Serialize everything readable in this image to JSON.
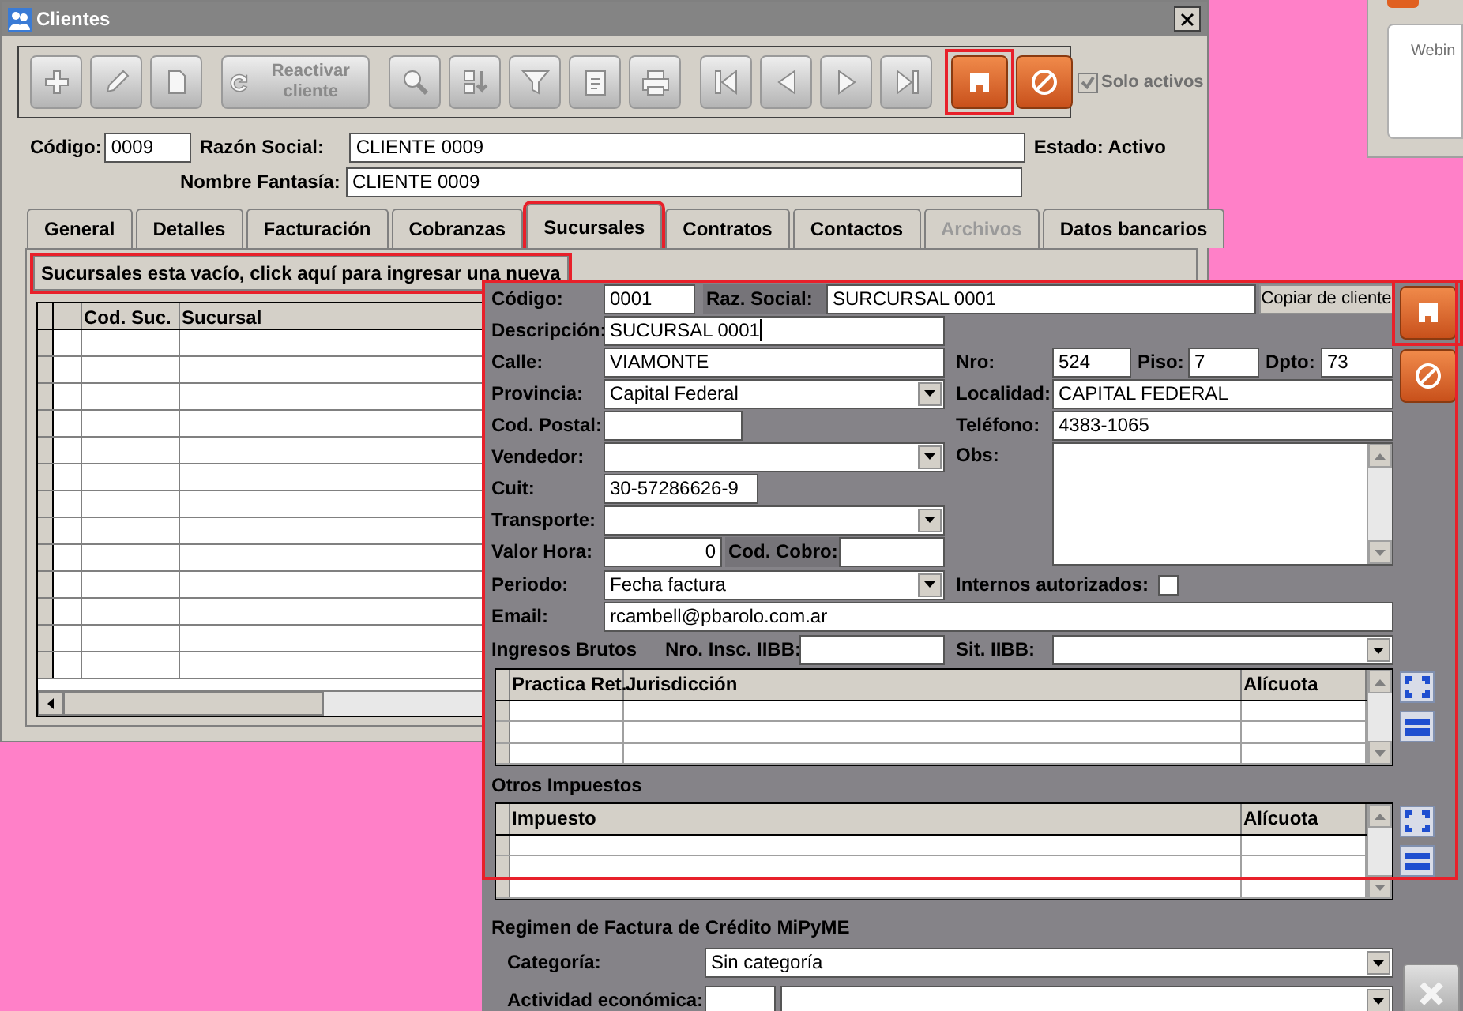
{
  "window": {
    "title": "Clientes"
  },
  "toolbar": {
    "buttons": [
      {
        "kind": "add",
        "disabled": true,
        "highlighted": false
      },
      {
        "kind": "edit",
        "disabled": true,
        "highlighted": false
      },
      {
        "kind": "delete",
        "disabled": true,
        "highlighted": false
      },
      {
        "kind": "reactivate",
        "label": "Reactivar cliente",
        "disabled": true,
        "highlighted": false
      },
      {
        "kind": "search",
        "disabled": true,
        "highlighted": false
      },
      {
        "kind": "sort",
        "disabled": true,
        "highlighted": false
      },
      {
        "kind": "filter",
        "disabled": true,
        "highlighted": false
      },
      {
        "kind": "report",
        "disabled": true,
        "highlighted": false
      },
      {
        "kind": "print",
        "disabled": true,
        "highlighted": false
      },
      {
        "kind": "first",
        "disabled": true,
        "highlighted": false
      },
      {
        "kind": "prev",
        "disabled": true,
        "highlighted": false
      },
      {
        "kind": "next",
        "disabled": true,
        "highlighted": false
      },
      {
        "kind": "last",
        "disabled": true,
        "highlighted": false
      },
      {
        "kind": "save",
        "disabled": false,
        "highlighted": true
      },
      {
        "kind": "cancel",
        "disabled": false,
        "highlighted": false
      }
    ]
  },
  "solo_activos": {
    "label": "Solo activos",
    "checked": true,
    "disabled": true
  },
  "header": {
    "codigo": {
      "label": "Código:",
      "value": "0009"
    },
    "razon_social": {
      "label": "Razón Social:",
      "value": "CLIENTE 0009"
    },
    "nombre_fantasia": {
      "label": "Nombre Fantasía:",
      "value": "CLIENTE 0009"
    },
    "estado": "Estado: Activo"
  },
  "tabs": [
    {
      "label": "General",
      "selected": false,
      "disabled": false,
      "highlighted": false
    },
    {
      "label": "Detalles",
      "selected": false,
      "disabled": false,
      "highlighted": false
    },
    {
      "label": "Facturación",
      "selected": false,
      "disabled": false,
      "highlighted": false
    },
    {
      "label": "Cobranzas",
      "selected": false,
      "disabled": false,
      "highlighted": false
    },
    {
      "label": "Sucursales",
      "selected": true,
      "disabled": false,
      "highlighted": true
    },
    {
      "label": "Contratos",
      "selected": false,
      "disabled": false,
      "highlighted": false
    },
    {
      "label": "Contactos",
      "selected": false,
      "disabled": false,
      "highlighted": false
    },
    {
      "label": "Archivos",
      "selected": false,
      "disabled": true,
      "highlighted": false
    },
    {
      "label": "Datos bancarios",
      "selected": false,
      "disabled": false,
      "highlighted": false
    }
  ],
  "banner": {
    "text": "Sucursales esta vacío, click aquí para ingresar una nueva",
    "highlighted": true
  },
  "sucursales_table": {
    "columns": [
      "Cod. Suc.",
      "Sucursal"
    ]
  },
  "sucursal": {
    "highlighted": true,
    "codigo": {
      "label": "Código:",
      "value": "0001"
    },
    "raz_social": {
      "label": "Raz. Social:",
      "value": "SURCURSAL 0001"
    },
    "copiar_button": "Copiar de cliente",
    "descripcion": {
      "label": "Descripción:",
      "value": "SUCURSAL 0001",
      "focused": true
    },
    "calle": {
      "label": "Calle:",
      "value": "VIAMONTE"
    },
    "nro": {
      "label": "Nro:",
      "value": "524"
    },
    "piso": {
      "label": "Piso:",
      "value": "7"
    },
    "dpto": {
      "label": "Dpto:",
      "value": "73"
    },
    "provincia": {
      "label": "Provincia:",
      "value": "Capital Federal"
    },
    "localidad": {
      "label": "Localidad:",
      "value": "CAPITAL FEDERAL"
    },
    "cod_postal": {
      "label": "Cod. Postal:"
    },
    "telefono": {
      "label": "Teléfono:",
      "value": "4383-1065"
    },
    "vendedor": {
      "label": "Vendedor:"
    },
    "obs": {
      "label": "Obs:"
    },
    "cuit": {
      "label": "Cuit:",
      "value": "30-57286626-9"
    },
    "transporte": {
      "label": "Transporte:"
    },
    "valor_hora": {
      "label": "Valor Hora:",
      "value": "0"
    },
    "cod_cobro": {
      "label": "Cod. Cobro:"
    },
    "periodo": {
      "label": "Periodo:",
      "value": "Fecha factura"
    },
    "internos_autorizados": {
      "label": "Internos autorizados:",
      "checked": false
    },
    "email": {
      "label": "Email:",
      "value": "rcambell@pbarolo.com.ar"
    },
    "ingresos_brutos": {
      "title": "Ingresos Brutos",
      "nro_insc": {
        "label": "Nro. Insc. IIBB:"
      },
      "sit": {
        "label": "Sit. IIBB:"
      }
    },
    "retenciones_table": {
      "columns": [
        "Practica Ret.",
        "Jurisdicción",
        "Alícuota"
      ]
    },
    "otros_impuestos": {
      "title": "Otros Impuestos",
      "columns": [
        "Impuesto",
        "Alícuota"
      ]
    },
    "mipyme": {
      "title": "Regimen de Factura de Crédito MiPyME",
      "categoria": {
        "label": "Categoría:",
        "value": "Sin categoría"
      },
      "actividad": {
        "label": "Actividad económica:"
      }
    }
  },
  "side_buttons": [
    {
      "kind": "save",
      "highlighted": true
    },
    {
      "kind": "cancel",
      "highlighted": false
    }
  ],
  "close_button": {
    "disabled": true
  },
  "background_window": {
    "text": "Webin"
  }
}
